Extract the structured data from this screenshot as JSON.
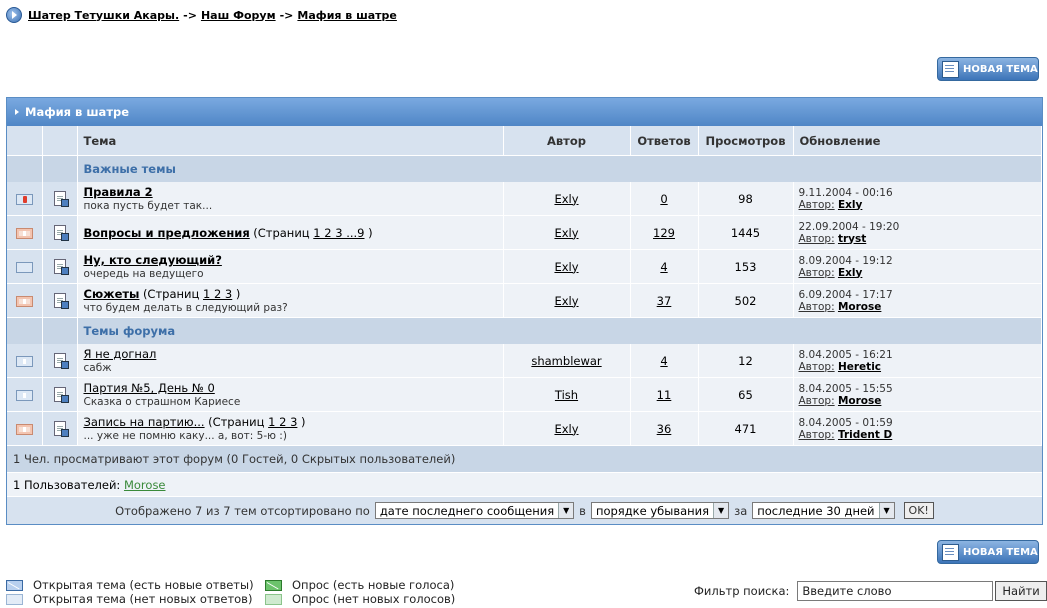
{
  "breadcrumb": {
    "items": [
      "Шатер Тетушки Акары.",
      "Наш Форум",
      "Мафия в шатре"
    ],
    "sep": "->"
  },
  "new_topic_label": "НОВАЯ ТЕМА",
  "forum": {
    "title": "Мафия в шатре",
    "columns": {
      "topic": "Тема",
      "author": "Автор",
      "replies": "Ответов",
      "views": "Просмотров",
      "updated": "Обновление"
    },
    "sections": {
      "important": "Важные темы",
      "topics": "Темы форума"
    },
    "pages_prefix": "(Страниц",
    "pages_suffix": ")",
    "author_prefix": "Автор:",
    "important": [
      {
        "title": "Правила 2",
        "desc": "пока пусть будет так...",
        "author": "Exly",
        "replies": "0",
        "views": "98",
        "date": "9.11.2004 - 00:16",
        "last": "Exly",
        "pages": ""
      },
      {
        "title": "Вопросы и предложения",
        "desc": "",
        "author": "Exly",
        "replies": "129",
        "views": "1445",
        "date": "22.09.2004 - 19:20",
        "last": "tryst",
        "pages": "1 2 3 ...9"
      },
      {
        "title": "Ну, кто следующий?",
        "desc": "очередь на ведущего",
        "author": "Exly",
        "replies": "4",
        "views": "153",
        "date": "8.09.2004 - 19:12",
        "last": "Exly",
        "pages": ""
      },
      {
        "title": "Сюжеты",
        "desc": "что будем делать в следующий раз?",
        "author": "Exly",
        "replies": "37",
        "views": "502",
        "date": "6.09.2004 - 17:17",
        "last": "Morose",
        "pages": "1 2 3"
      }
    ],
    "topics": [
      {
        "title": "Я не догнал",
        "desc": "сабж",
        "author": "shamblewar",
        "replies": "4",
        "views": "12",
        "date": "8.04.2005 - 16:21",
        "last": "Heretic",
        "pages": ""
      },
      {
        "title": "Партия №5, День № 0",
        "desc": "Сказка о страшном Кариесе",
        "author": "Tish",
        "replies": "11",
        "views": "65",
        "date": "8.04.2005 - 15:55",
        "last": "Morose",
        "pages": ""
      },
      {
        "title": "Запись на партию...",
        "desc": "... уже не помню каку... а, вот: 5-ю :)",
        "author": "Exly",
        "replies": "36",
        "views": "471",
        "date": "8.04.2005 - 01:59",
        "last": "Trident D",
        "pages": "1 2 3"
      }
    ],
    "stats": "1 Чел. просматривают этот форум (0 Гостей, 0 Скрытых пользователей)",
    "users_label": "1 Пользователей:",
    "users_name": "Morose",
    "sort": {
      "shown": "Отображено 7 из 7 тем отсортировано по",
      "by": "дате последнего сообщения",
      "in": "в",
      "order": "порядке убывания",
      "for": "за",
      "period": "последние 30 дней",
      "ok": "OK!"
    }
  },
  "legend": [
    "Открытая тема (есть новые ответы)",
    "Открытая тема (нет новых ответов)",
    "Опрос (есть новые голоса)",
    "Опрос (нет новых голосов)"
  ],
  "search": {
    "label": "Фильтр поиска:",
    "value": "Введите слово",
    "button": "Найти"
  }
}
